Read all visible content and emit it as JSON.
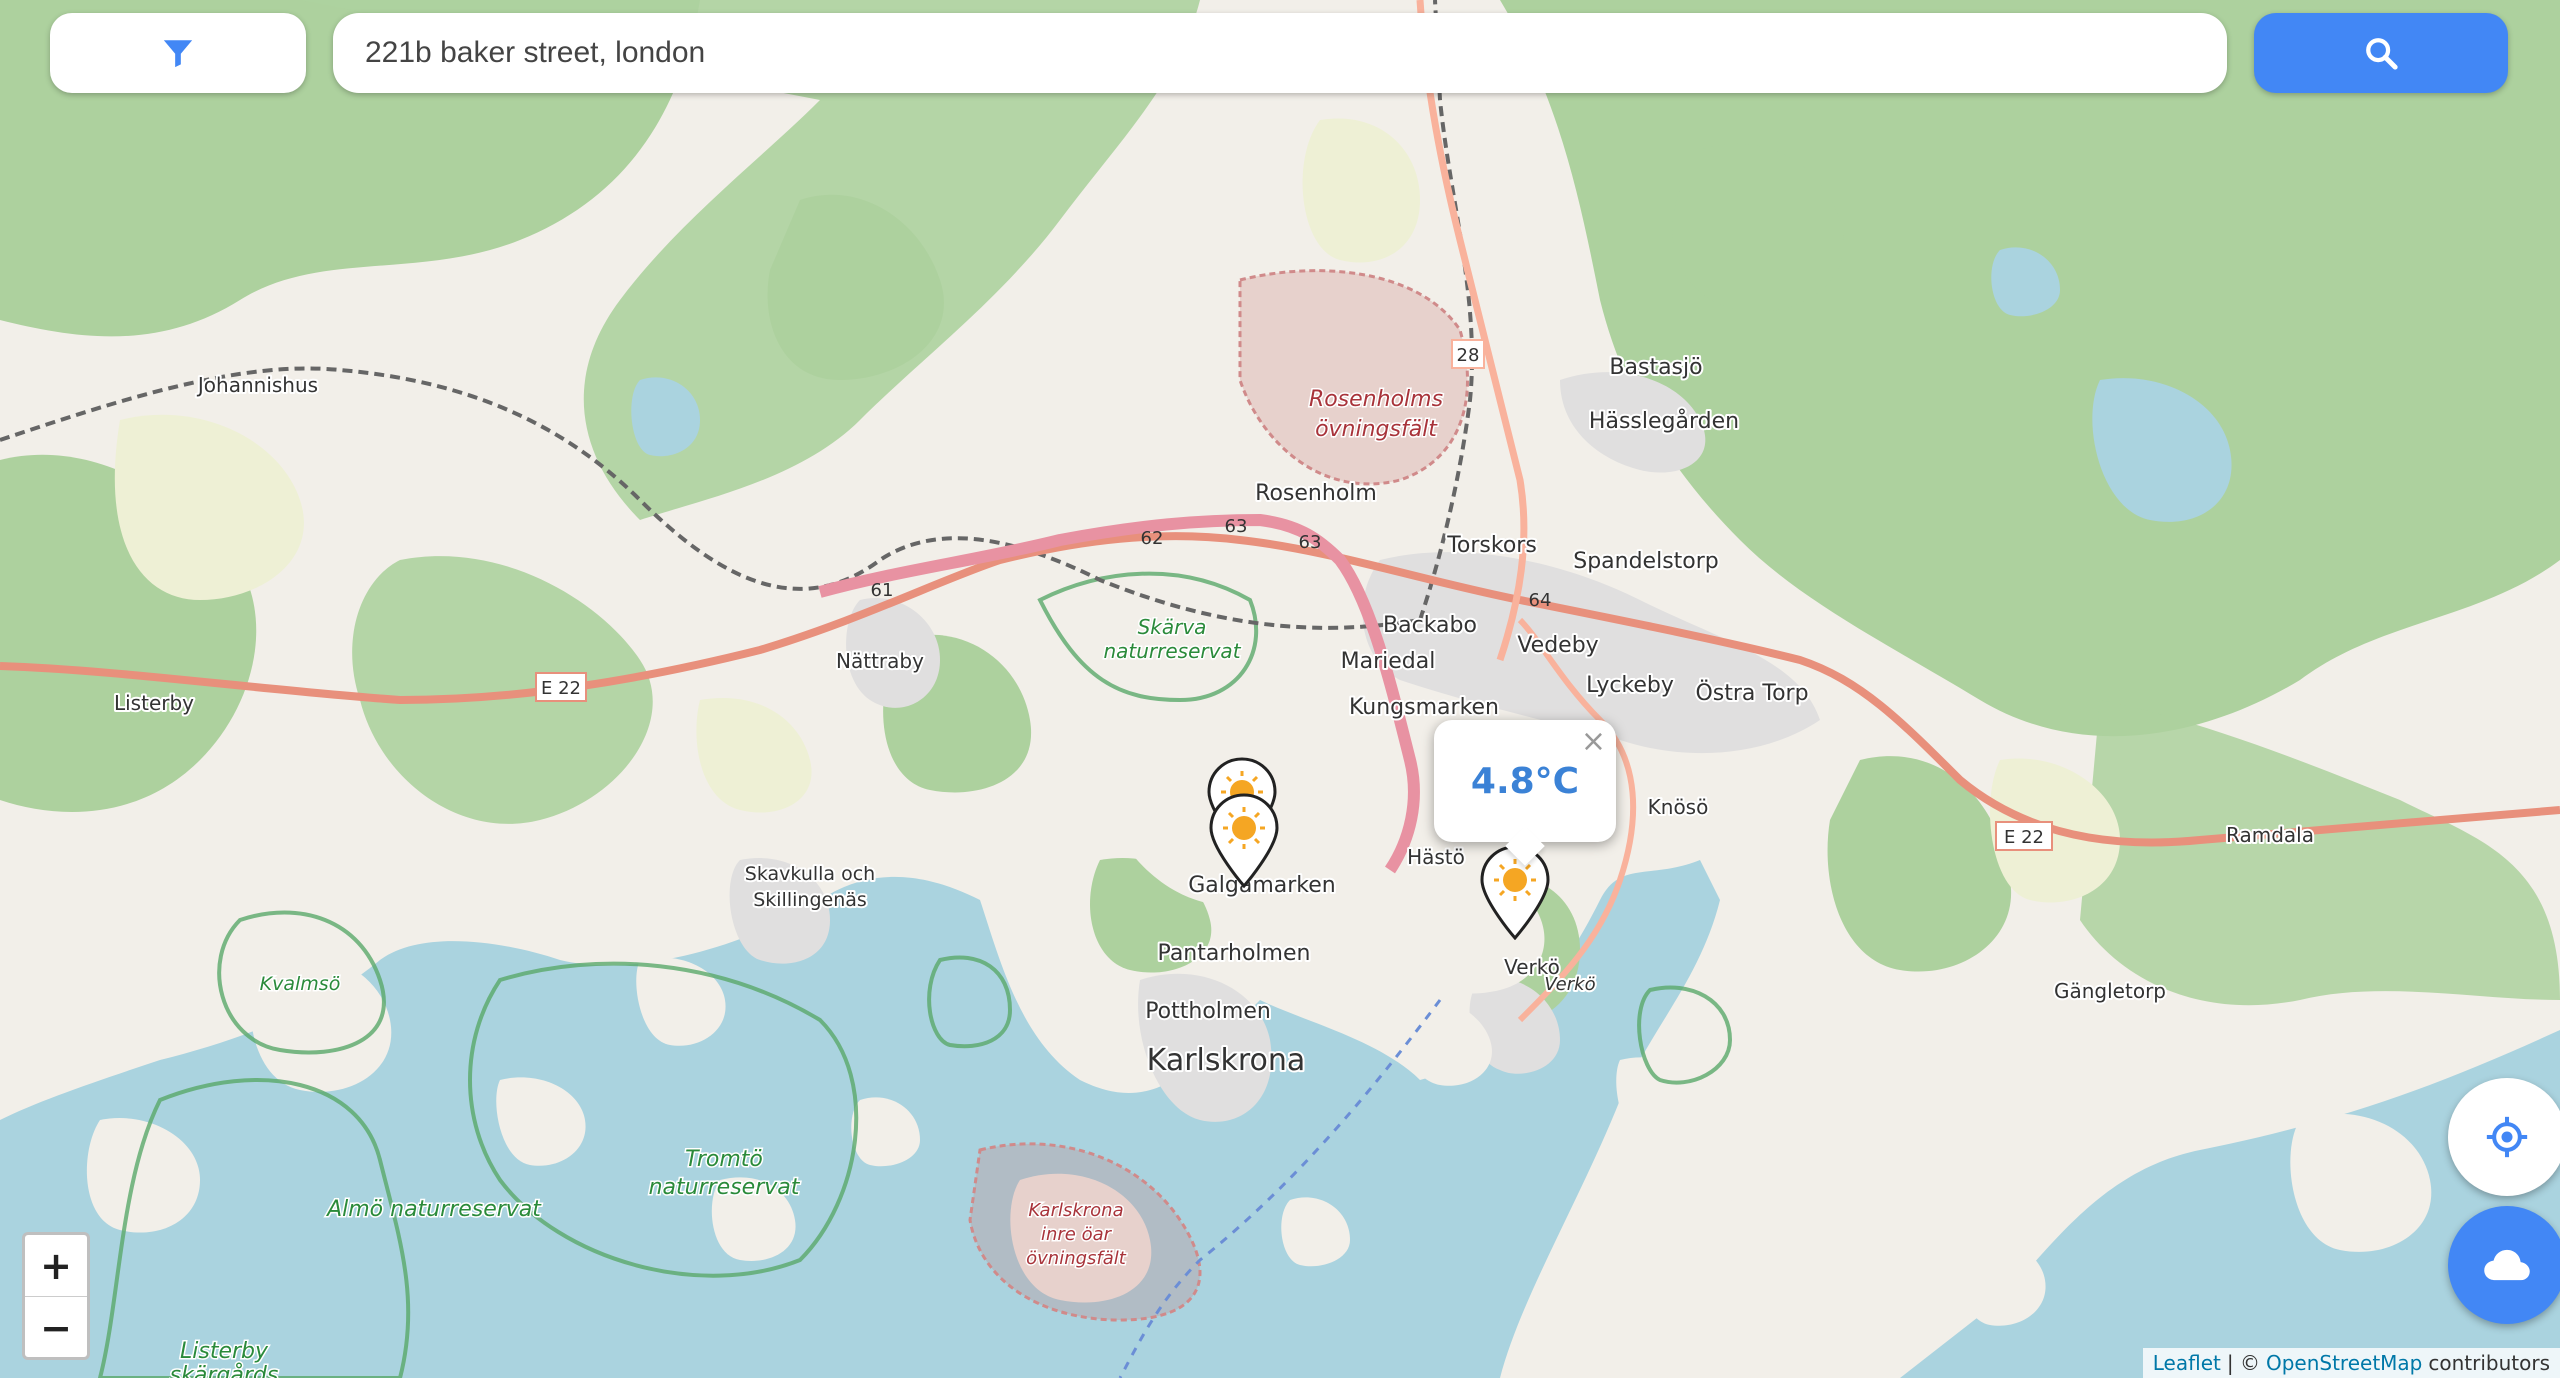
{
  "search": {
    "value": "221b baker street, london",
    "placeholder": ""
  },
  "icons": {
    "filter": "filter-funnel-icon",
    "search": "search-magnifier-icon",
    "locate": "crosshair-locate-icon",
    "weather": "cloud-icon",
    "marker": "sun-weather-icon"
  },
  "colors": {
    "accent": "#4287f5",
    "temperature_text": "#3b82d6",
    "water": "#aad3df",
    "forest": "#add19e",
    "motorway": "#e892a2",
    "trunk": "#f9b29c"
  },
  "popup": {
    "temperature": "4.8°C",
    "close": "×"
  },
  "zoom": {
    "in": "+",
    "out": "−"
  },
  "attribution": {
    "leaflet": "Leaflet",
    "separator": "| ©",
    "osm": "OpenStreetMap",
    "suffix": "contributors"
  },
  "map": {
    "places": {
      "johannishus": "Johannishus",
      "bastasjo": "Bastasjö",
      "hasslegarden": "Hässlegården",
      "rosenholm": "Rosenholm",
      "torskors": "Torskors",
      "spandelstorp": "Spandelstorp",
      "backabo": "Backabo",
      "vedeby": "Vedeby",
      "mariedal": "Mariedal",
      "nattraby": "Nättraby",
      "lyckeby": "Lyckeby",
      "ostra_torp": "Östra Torp",
      "listerby": "Listerby",
      "kungsmarken": "Kungsmarken",
      "knoso": "Knösö",
      "ramdala": "Ramdala",
      "hasto": "Hästö",
      "skavkulla_1": "Skavkulla och",
      "skavkulla_2": "Skillingenäs",
      "galgamarken": "Galgamarken",
      "pantarholmen": "Pantarholmen",
      "verko": "Verkö",
      "gangletorp": "Gängletorp",
      "pottholmen": "Pottholmen",
      "karlskrona": "Karlskrona"
    },
    "islands": {
      "verko": "Verkö"
    },
    "reserves": {
      "skarva_1": "Skärva",
      "skarva_2": "naturreservat",
      "kvalmso": "Kvalmsö",
      "tromto_1": "Tromtö",
      "tromto_2": "naturreservat",
      "almo": "Almö naturreservat",
      "listerby_1": "Listerby",
      "listerby_2": "skärgårds"
    },
    "military": {
      "rosenholms_1": "Rosenholms",
      "rosenholms_2": "övningsfält",
      "inre_1": "Karlskrona",
      "inre_2": "inre öar",
      "inre_3": "övningsfält"
    },
    "roads": {
      "e22_west": "E 22",
      "e22_east": "E 22",
      "r28": "28",
      "r61": "61",
      "r62": "62",
      "r63a": "63",
      "r63b": "63",
      "r64": "64"
    }
  }
}
